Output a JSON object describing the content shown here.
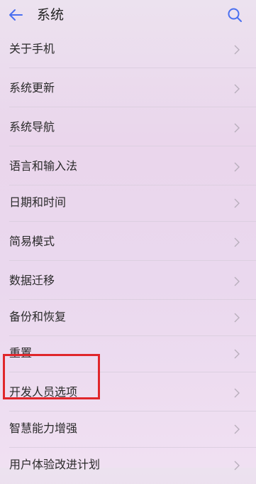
{
  "header": {
    "title": "系统",
    "back_icon": "arrow-left-icon",
    "search_icon": "search-icon"
  },
  "menu": [
    {
      "label": "关于手机"
    },
    {
      "label": "系统更新"
    },
    {
      "label": "系统导航"
    },
    {
      "label": "语言和输入法"
    },
    {
      "label": "日期和时间"
    },
    {
      "label": "简易模式"
    },
    {
      "label": "数据迁移"
    },
    {
      "label": "备份和恢复"
    },
    {
      "label": "重置"
    },
    {
      "label": "开发人员选项"
    },
    {
      "label": "智慧能力增强"
    },
    {
      "label": "用户体验改进计划"
    }
  ],
  "colors": {
    "accent": "#4a6ff0",
    "highlight": "#e0262b",
    "chevron": "#b8aebc"
  }
}
